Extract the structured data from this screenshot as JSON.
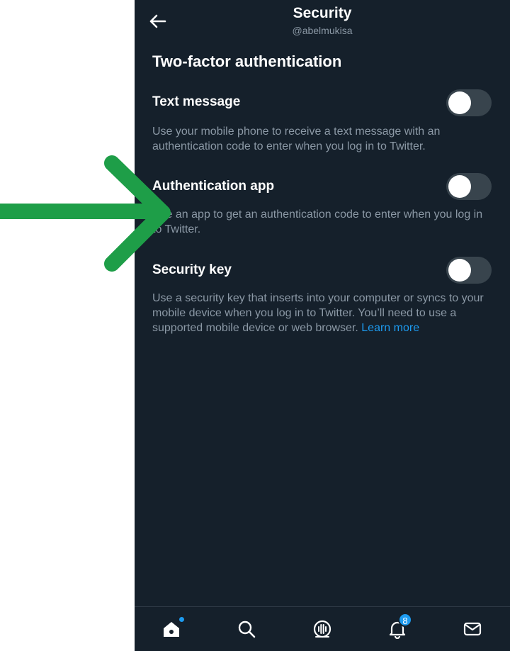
{
  "header": {
    "title": "Security",
    "handle": "@abelmukisa"
  },
  "section_title": "Two-factor authentication",
  "options": [
    {
      "label": "Text message",
      "description": "Use your mobile phone to receive a text message with an authentication code to enter when you log in to Twitter.",
      "enabled": false
    },
    {
      "label": "Authentication app",
      "description": "Use an app to get an authentication code to enter when you log in to Twitter.",
      "enabled": false
    },
    {
      "label": "Security key",
      "description": "Use a security key that inserts into your computer or syncs to your mobile device when you log in to Twitter. You’ll need to use a supported mobile device or web browser.",
      "link_text": "Learn more",
      "enabled": false
    }
  ],
  "bottom_nav": {
    "items": [
      "home-icon",
      "search-icon",
      "spaces-icon",
      "notifications-icon",
      "messages-icon"
    ],
    "notification_count": "8"
  },
  "colors": {
    "background": "#15202b",
    "accent": "#1d9bf0",
    "secondary_text": "#8b98a5",
    "toggle_off": "#38444d",
    "annotation_arrow": "#1e9e48"
  }
}
